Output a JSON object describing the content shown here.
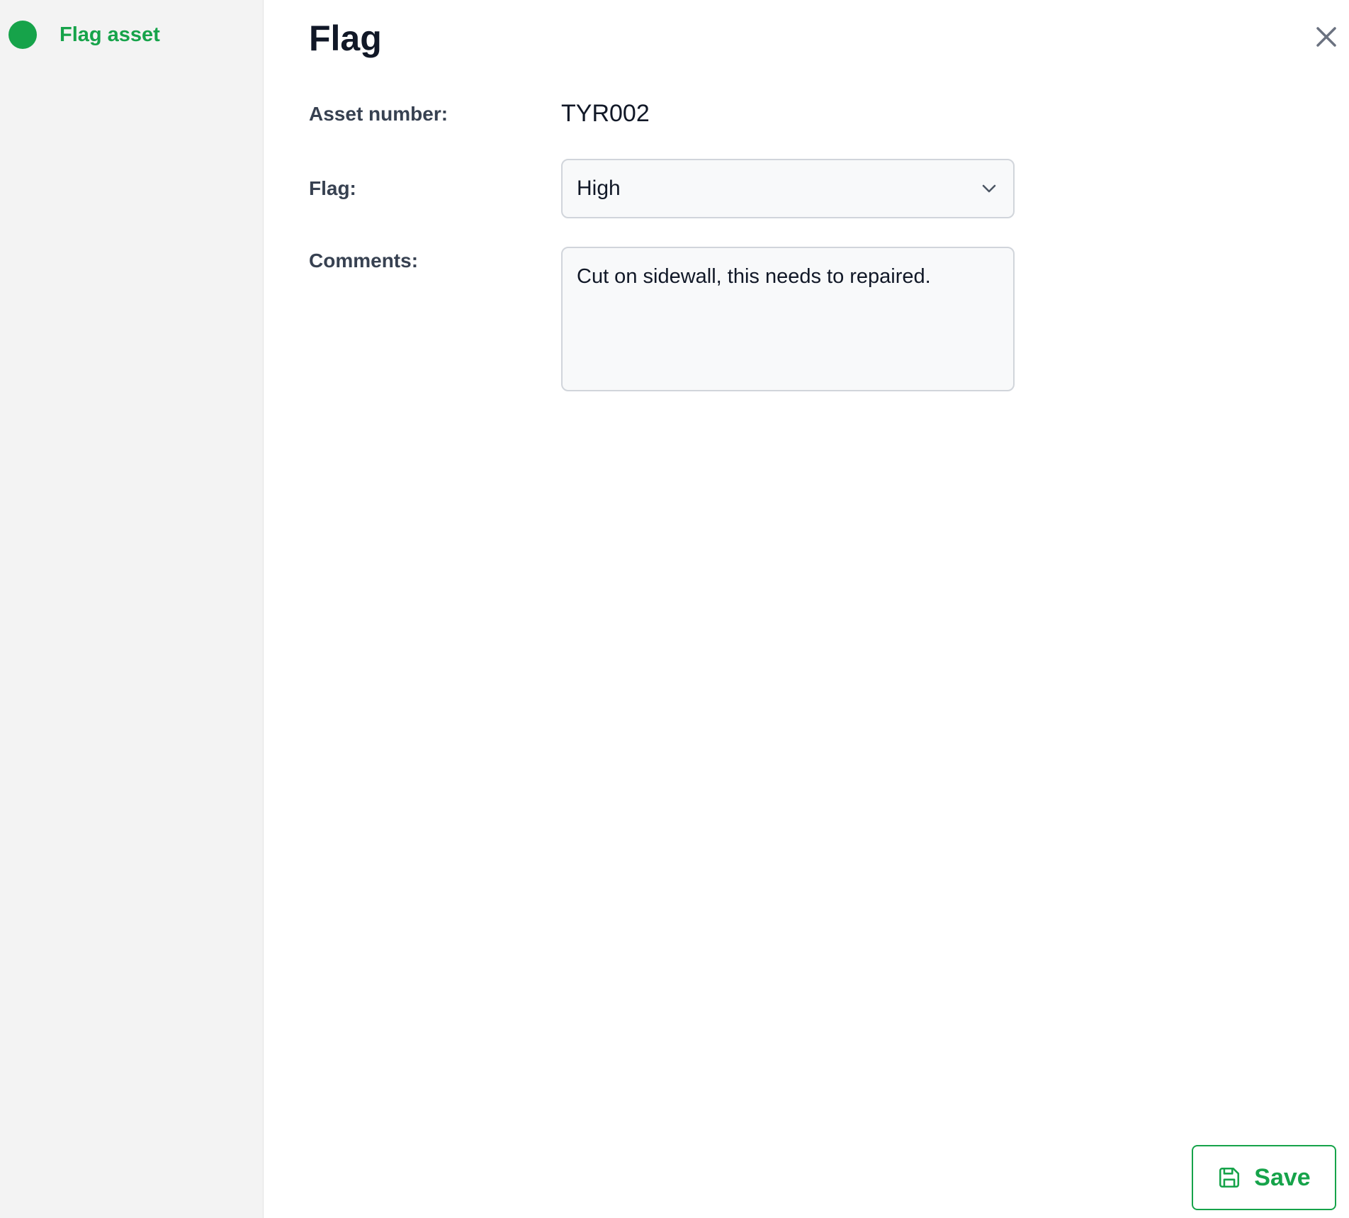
{
  "sidebar": {
    "steps": [
      {
        "label": "Flag asset",
        "status": "active"
      }
    ]
  },
  "main": {
    "title": "Flag",
    "close_icon": "close-icon",
    "fields": {
      "asset_number": {
        "label": "Asset number:",
        "value": "TYR002"
      },
      "flag": {
        "label": "Flag:",
        "selected": "High"
      },
      "comments": {
        "label": "Comments:",
        "value": "Cut on sidewall, this needs to repaired."
      }
    },
    "save_button": {
      "label": "Save",
      "icon": "floppy-disk-icon"
    }
  },
  "colors": {
    "accent": "#16a34a",
    "sidebar_bg": "#f3f3f3",
    "input_bg": "#f8f9fa",
    "input_border": "#d1d5db",
    "title_text": "#111827",
    "label_text": "#374151",
    "close_icon": "#6b7280"
  }
}
